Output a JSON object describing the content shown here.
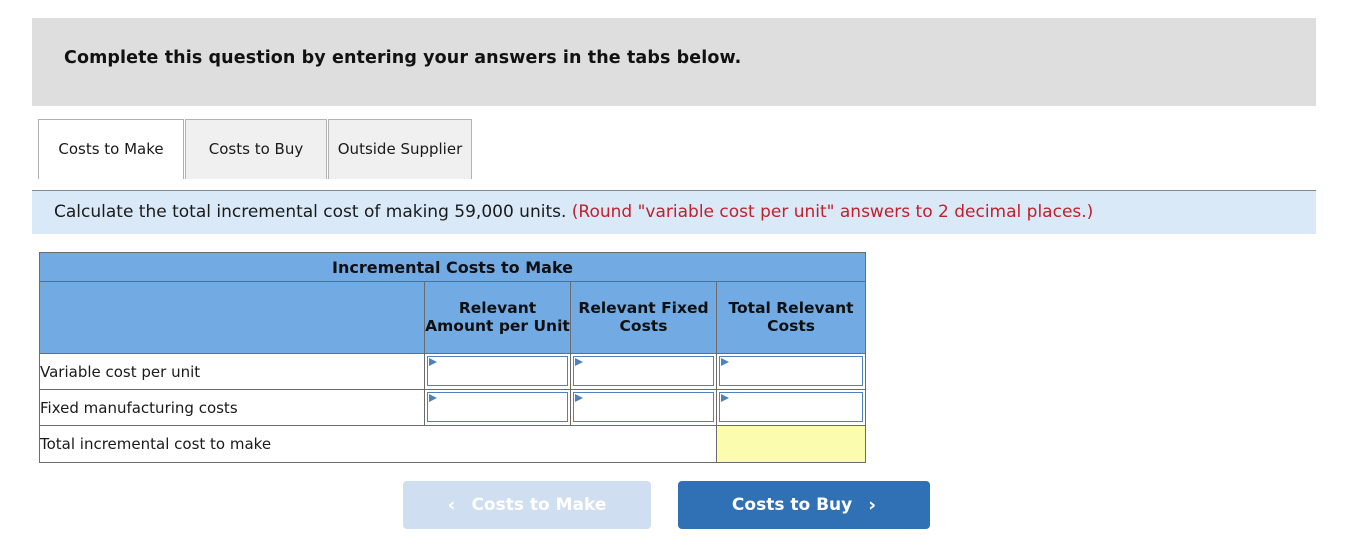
{
  "banner": {
    "text": "Complete this question by entering your answers in the tabs below."
  },
  "tabs": [
    {
      "label": "Costs to Make",
      "active": true
    },
    {
      "label": "Costs to Buy",
      "active": false
    },
    {
      "label": "Outside Supplier",
      "active": false
    }
  ],
  "requirement": {
    "text": "Calculate the total incremental cost of making 59,000 units.",
    "note": "(Round \"variable cost per unit\" answers to 2 decimal places.)"
  },
  "table": {
    "title": "Incremental Costs to Make",
    "columns": [
      "",
      "Relevant Amount per Unit",
      "Relevant Fixed Costs",
      "Total Relevant Costs"
    ],
    "rows": [
      {
        "label": "Variable cost per unit",
        "cells": [
          {
            "type": "input",
            "value": ""
          },
          {
            "type": "input",
            "value": ""
          },
          {
            "type": "input",
            "value": ""
          }
        ]
      },
      {
        "label": "Fixed manufacturing costs",
        "cells": [
          {
            "type": "input",
            "value": ""
          },
          {
            "type": "input",
            "value": ""
          },
          {
            "type": "input",
            "value": ""
          }
        ]
      }
    ],
    "total_row": {
      "label": "Total incremental cost to make",
      "value": ""
    }
  },
  "nav": {
    "prev_label": "Costs to Make",
    "prev_icon": "chevron-left-icon",
    "prev_glyph": "‹",
    "next_label": "Costs to Buy",
    "next_icon": "chevron-right-icon",
    "next_glyph": "›"
  },
  "colors": {
    "banner_bg": "#dedede",
    "info_bg": "#d9e9f8",
    "note_red": "#c0202a",
    "header_blue": "#72aae4",
    "input_border": "#4e82bd",
    "answer_yellow": "#fcfcae",
    "button_blue": "#3071b5",
    "button_disabled": "#cfdff1"
  }
}
